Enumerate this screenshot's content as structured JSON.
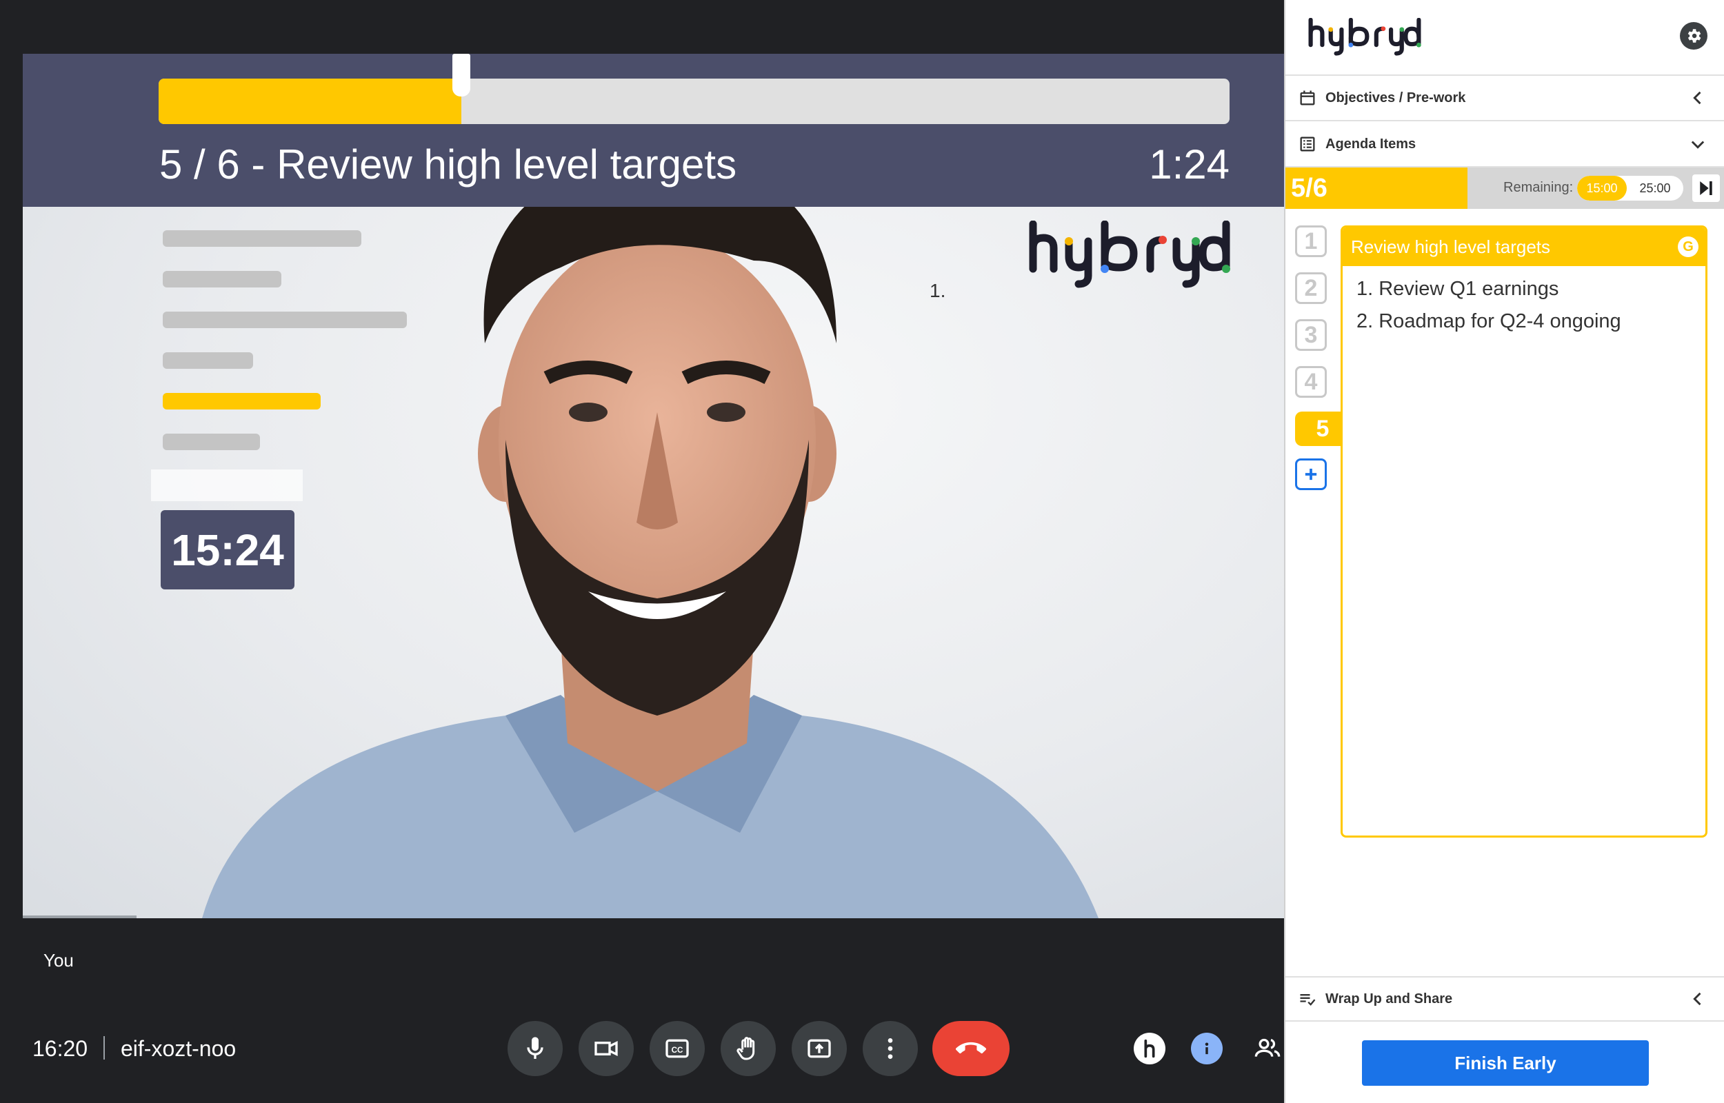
{
  "slide": {
    "progress_fraction": 0.283,
    "title": "5 / 6 - Review high level targets",
    "time": "1:24",
    "countdown": "15:24",
    "list_marker": "1."
  },
  "participant": {
    "label": "You"
  },
  "bottom_bar": {
    "time": "16:20",
    "meeting_code": "eif-xozt-noo",
    "controls": [
      "mic-icon",
      "camera-icon",
      "captions-icon",
      "raise-hand-icon",
      "present-icon",
      "more-options-icon",
      "end-call-icon"
    ],
    "side": [
      "hybryd-h-icon",
      "info-icon",
      "people-icon"
    ]
  },
  "panel": {
    "brand": "hybryd",
    "sections": {
      "objectives": "Objectives / Pre-work",
      "agenda": "Agenda Items",
      "wrap": "Wrap Up and Share"
    },
    "progress": {
      "count": "5/6",
      "remaining_label": "Remaining:",
      "remaining_current": "15:00",
      "remaining_total": "25:00"
    },
    "tabs": [
      "1",
      "2",
      "3",
      "4",
      "5"
    ],
    "active_tab": "5",
    "item": {
      "title": "Review high level targets",
      "badge": "G",
      "points": [
        "1.  Review Q1 earnings",
        "2.  Roadmap for Q2-4 ongoing"
      ]
    },
    "finish_button": "Finish Early"
  },
  "colors": {
    "accent": "#ffc800",
    "header": "#4b4e6a",
    "primary": "#1a73e8",
    "end_call": "#ea4335"
  }
}
